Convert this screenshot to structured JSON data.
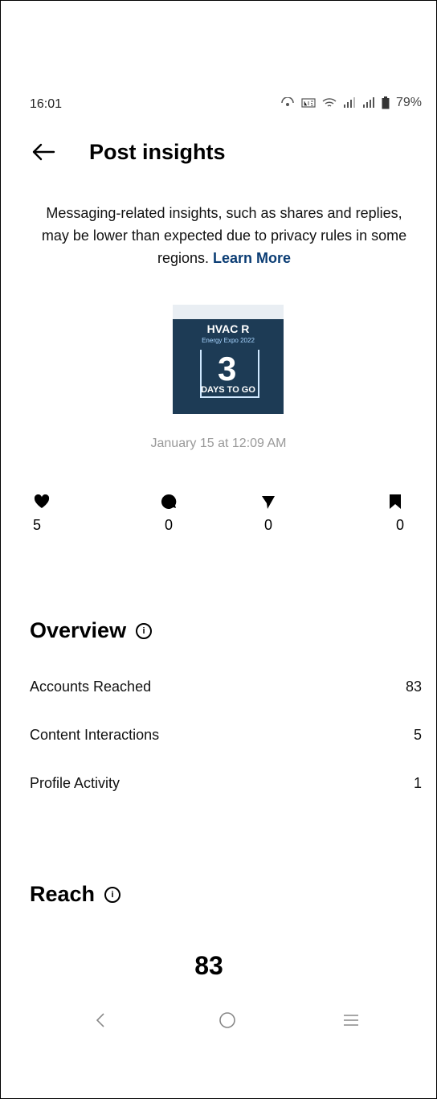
{
  "status_bar": {
    "time": "16:01",
    "battery": "79%",
    "icons": [
      "hotspot-icon",
      "volte-lte-icon",
      "wifi-icon",
      "signal-icon",
      "signal-icon",
      "battery-icon"
    ]
  },
  "header": {
    "title": "Post insights",
    "back_icon": "arrow-left-icon"
  },
  "notice": {
    "text": "Messaging-related insights, such as shares and replies, may be lower than expected due to privacy rules in some regions. ",
    "link": "Learn More"
  },
  "post": {
    "thumbnail": {
      "title": "HVAC R",
      "subtitle": "Energy Expo 2022",
      "number": "3",
      "caption": "DAYS TO GO"
    },
    "date": "January 15 at 12:09 AM"
  },
  "stats": [
    {
      "icon": "heart-icon",
      "value": "5"
    },
    {
      "icon": "comment-icon",
      "value": "0"
    },
    {
      "icon": "share-icon",
      "value": "0"
    },
    {
      "icon": "bookmark-icon",
      "value": "0"
    }
  ],
  "overview": {
    "title": "Overview",
    "rows": [
      {
        "label": "Accounts Reached",
        "value": "83"
      },
      {
        "label": "Content Interactions",
        "value": "5"
      },
      {
        "label": "Profile Activity",
        "value": "1"
      }
    ]
  },
  "reach": {
    "title": "Reach",
    "value": "83"
  },
  "nav": {
    "back": "chevron-left-icon",
    "home": "circle-home-icon",
    "recents": "menu-lines-icon"
  },
  "colors": {
    "link": "#0b3d74",
    "muted": "#999999",
    "thumb_bg": "#1d3b55"
  }
}
